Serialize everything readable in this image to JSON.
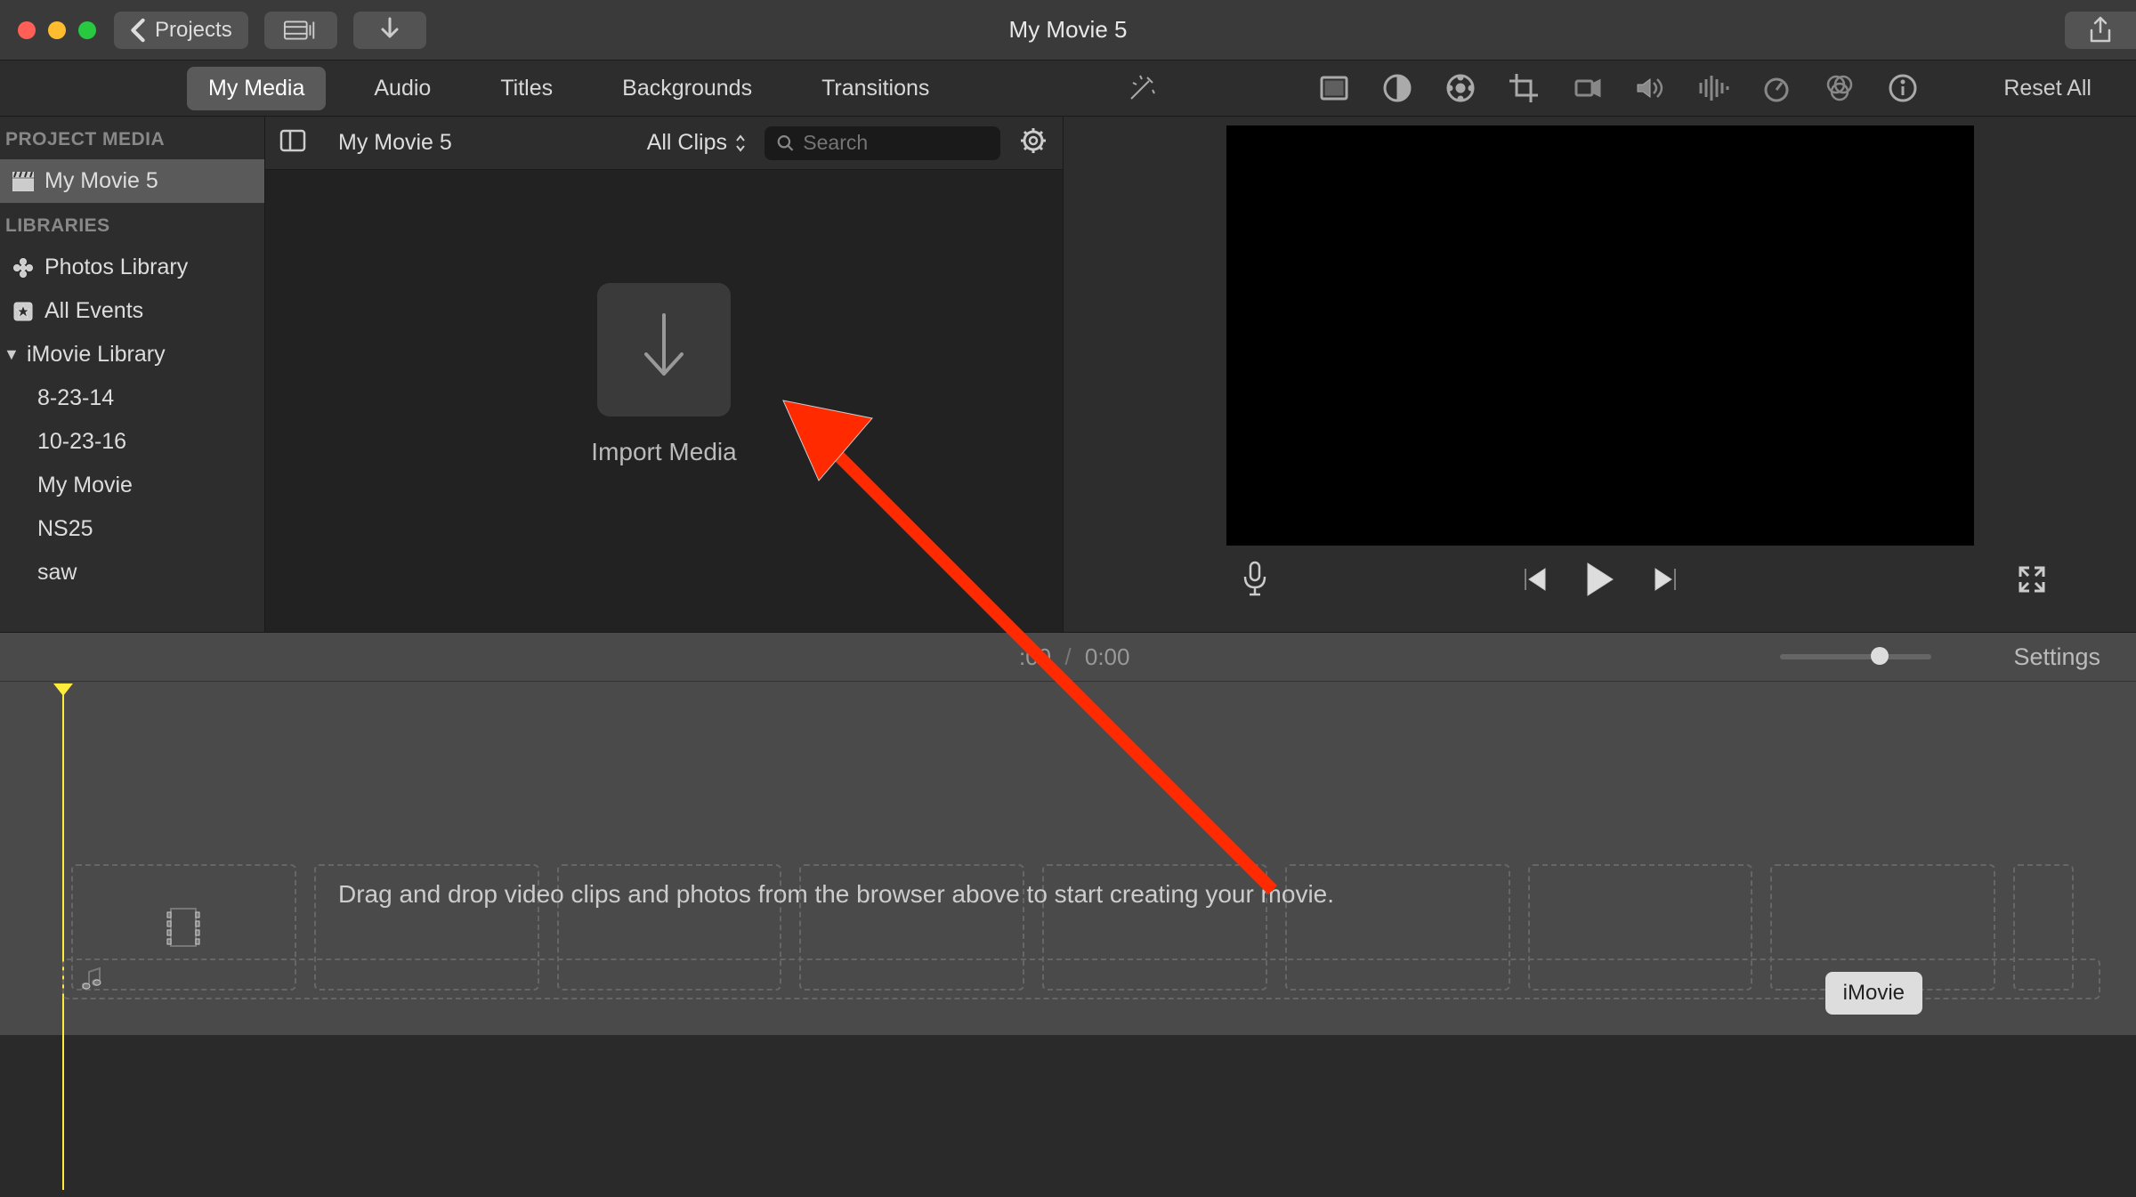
{
  "app_title": "My Movie 5",
  "toolbar": {
    "back_label": "Projects"
  },
  "tabs": [
    "My Media",
    "Audio",
    "Titles",
    "Backgrounds",
    "Transitions"
  ],
  "active_tab": 0,
  "reset_all_label": "Reset All",
  "sidebar": {
    "heading_project": "PROJECT MEDIA",
    "project_item": "My Movie 5",
    "heading_libraries": "LIBRARIES",
    "photos_library": "Photos Library",
    "all_events": "All Events",
    "imovie_library": "iMovie Library",
    "events": [
      "8-23-14",
      "10-23-16",
      "My Movie",
      "NS25",
      "saw"
    ]
  },
  "browser": {
    "title": "My Movie 5",
    "clips_filter": "All Clips",
    "search_placeholder": "Search",
    "import_label": "Import Media"
  },
  "time": {
    "current": ":00",
    "sep": "/",
    "total": "0:00"
  },
  "settings_label": "Settings",
  "timeline_hint": "Drag and drop video clips and photos from the browser above to start creating your movie.",
  "tooltip": "iMovie"
}
